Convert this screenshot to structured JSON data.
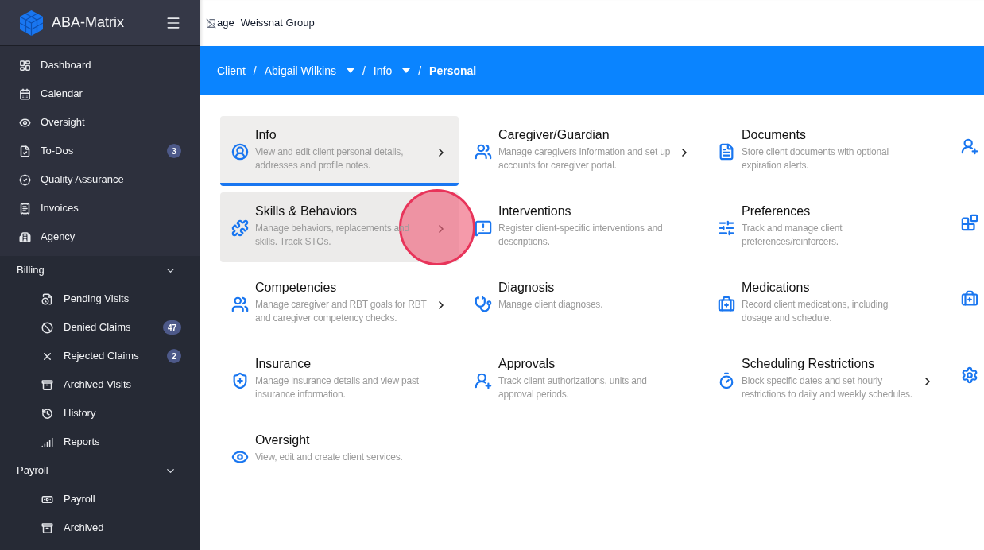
{
  "sidebar": {
    "brand": "ABA-Matrix",
    "items": [
      {
        "label": "Dashboard"
      },
      {
        "label": "Calendar"
      },
      {
        "label": "Oversight"
      },
      {
        "label": "To-Dos",
        "badge": "3"
      },
      {
        "label": "Quality Assurance"
      },
      {
        "label": "Invoices"
      },
      {
        "label": "Agency"
      }
    ],
    "sections": [
      {
        "title": "Billing",
        "expanded": true,
        "items": [
          {
            "label": "Pending Visits"
          },
          {
            "label": "Denied Claims",
            "badge": "47"
          },
          {
            "label": "Rejected Claims",
            "badge": "2"
          },
          {
            "label": "Archived Visits"
          },
          {
            "label": "History"
          },
          {
            "label": "Reports"
          }
        ]
      },
      {
        "title": "Payroll",
        "expanded": true,
        "items": [
          {
            "label": "Payroll"
          },
          {
            "label": "Archived"
          }
        ]
      }
    ]
  },
  "header": {
    "image_alt": "age",
    "organization": "Weissnat Group"
  },
  "breadcrumb": [
    {
      "label": "Client",
      "dropdown": false,
      "current": false
    },
    {
      "separator": "/",
      "label": "Abigail Wilkins",
      "dropdown": true,
      "current": false
    },
    {
      "separator": "/",
      "label": "Info",
      "dropdown": true,
      "current": false
    },
    {
      "separator": "/",
      "label": "Personal",
      "dropdown": false,
      "current": true
    }
  ],
  "cards": [
    {
      "kind": "full",
      "title": "Info",
      "description": "View and edit client personal details, addresses and profile notes.",
      "chevron": true,
      "selected": true,
      "hovered": false
    },
    {
      "kind": "full",
      "title": "Caregiver/Guardian",
      "description": "Manage caregivers information and set up accounts for caregiver portal.",
      "chevron": true,
      "selected": false,
      "hovered": false
    },
    {
      "kind": "full",
      "title": "Documents",
      "description": "Store client documents with optional expiration alerts.",
      "chevron": false,
      "selected": false,
      "hovered": false
    },
    {
      "kind": "clipped"
    },
    {
      "kind": "full",
      "title": "Skills & Behaviors",
      "description": "Manage behaviors, replacements and skills. Track STOs.",
      "chevron": true,
      "selected": false,
      "hovered": true
    },
    {
      "kind": "full",
      "title": "Interventions",
      "description": "Register client-specific interventions and descriptions.",
      "chevron": false,
      "selected": false,
      "hovered": false
    },
    {
      "kind": "full",
      "title": "Preferences",
      "description": "Track and manage client preferences/reinforcers.",
      "chevron": false,
      "selected": false,
      "hovered": false
    },
    {
      "kind": "clipped"
    },
    {
      "kind": "full",
      "title": "Competencies",
      "description": "Manage caregiver and RBT goals for RBT and caregiver competency checks.",
      "chevron": true,
      "selected": false,
      "hovered": false
    },
    {
      "kind": "full",
      "title": "Diagnosis",
      "description": "Manage client diagnoses.",
      "chevron": false,
      "selected": false,
      "hovered": false
    },
    {
      "kind": "full",
      "title": "Medications",
      "description": "Record client medications, including dosage and schedule.",
      "chevron": false,
      "selected": false,
      "hovered": false
    },
    {
      "kind": "clipped"
    },
    {
      "kind": "full",
      "title": "Insurance",
      "description": "Manage insurance details and view past insurance information.",
      "chevron": false,
      "selected": false,
      "hovered": false
    },
    {
      "kind": "full",
      "title": "Approvals",
      "description": "Track client authorizations, units and approval periods.",
      "chevron": false,
      "selected": false,
      "hovered": false
    },
    {
      "kind": "full",
      "title": "Scheduling Restrictions",
      "description": "Block specific dates and set hourly restrictions to daily and weekly schedules.",
      "chevron": true,
      "selected": false,
      "hovered": false
    },
    {
      "kind": "clipped"
    },
    {
      "kind": "full",
      "title": "Oversight",
      "description": "View, edit and create client services.",
      "chevron": false,
      "selected": false,
      "hovered": false
    }
  ]
}
